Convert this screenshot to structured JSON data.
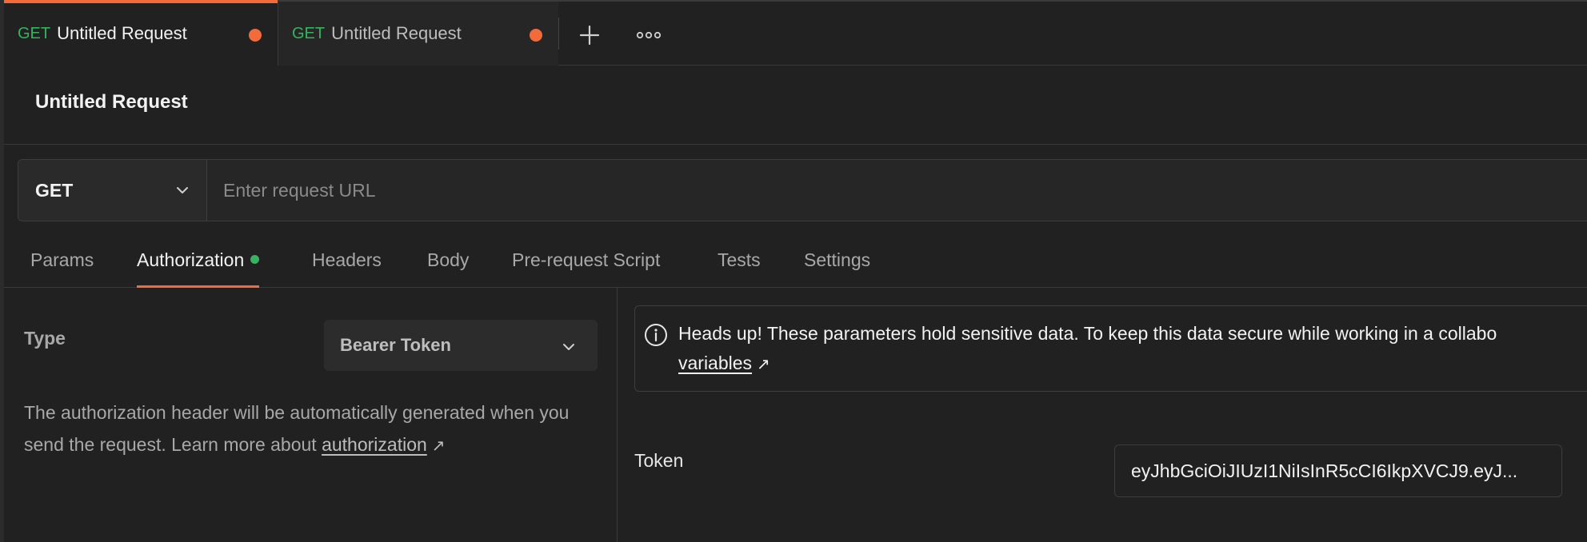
{
  "tabs": [
    {
      "method": "GET",
      "name": "Untitled Request"
    },
    {
      "method": "GET",
      "name": "Untitled Request"
    }
  ],
  "request": {
    "title": "Untitled Request",
    "method": "GET",
    "url_placeholder": "Enter request URL",
    "url_value": ""
  },
  "request_tabs": {
    "params": "Params",
    "authorization": "Authorization",
    "headers": "Headers",
    "body": "Body",
    "pre_request": "Pre-request Script",
    "tests": "Tests",
    "settings": "Settings"
  },
  "auth": {
    "type_label": "Type",
    "type_value": "Bearer Token",
    "description": "The authorization header will be automatically generated when you send the request. Learn more about ",
    "description_link": "authorization",
    "notice_text": "Heads up! These parameters hold sensitive data. To keep this data secure while working in a collabo",
    "notice_link": "variables",
    "token_label": "Token",
    "token_value": "eyJhbGciOiJIUzI1NiIsInR5cCI6IkpXVCJ9.eyJ..."
  },
  "icons": {
    "plus": "plus-icon",
    "more": "more-horizontal-icon",
    "chevron": "chevron-down-icon",
    "info": "info-icon",
    "external": "arrow-up-right-icon"
  },
  "colors": {
    "accent": "#f26b3a",
    "get_method": "#35b35d",
    "background": "#212121"
  }
}
